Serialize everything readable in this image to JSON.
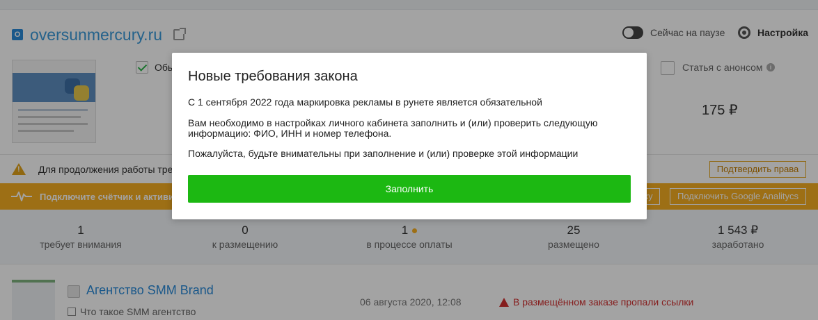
{
  "site": {
    "badge": "O",
    "name": "oversunmercury.ru"
  },
  "header": {
    "pause_label": "Сейчас на паузе",
    "settings_label": "Настройка"
  },
  "options": {
    "checked_label": "Обь",
    "anons_label": "Статья с анонсом",
    "info_glyph": "i",
    "price": "175 ₽"
  },
  "notice": {
    "text": "Для продолжения работы тре",
    "confirm_button": "Подтвердить права"
  },
  "analytics_band": {
    "text": "Подключите счётчик и активир",
    "ym_button": "ку",
    "ga_button": "Подключить Google Analitycs"
  },
  "stats": [
    {
      "value": "1",
      "label": "требует внимания"
    },
    {
      "value": "0",
      "label": "к размещению"
    },
    {
      "value": "1",
      "label": "в процессе оплаты"
    },
    {
      "value": "25",
      "label": "размещено"
    },
    {
      "value": "1 543 ₽",
      "label": "заработано"
    }
  ],
  "entry": {
    "title": "Агентство SMM Brand",
    "subtitle": "Что такое SMM агентство",
    "date": "06 августа 2020, 12:08",
    "warning": "В размещённом заказе пропали ссылки"
  },
  "modal": {
    "title": "Новые требования закона",
    "p1": "С 1 сентября 2022 года маркировка рекламы в рунете является обязательной",
    "p2": "Вам необходимо в настройках личного кабинета заполнить и (или) проверить следующую информацию: ФИО, ИНН и номер телефона.",
    "p3": "Пожалуйста, будьте внимательны при заполнение и (или) проверке этой информации",
    "button": "Заполнить"
  },
  "colors": {
    "accent_blue": "#2a8ad8",
    "primary_green": "#1cb812",
    "warning_orange": "#f6ae22",
    "error_red": "#d12f2f"
  }
}
